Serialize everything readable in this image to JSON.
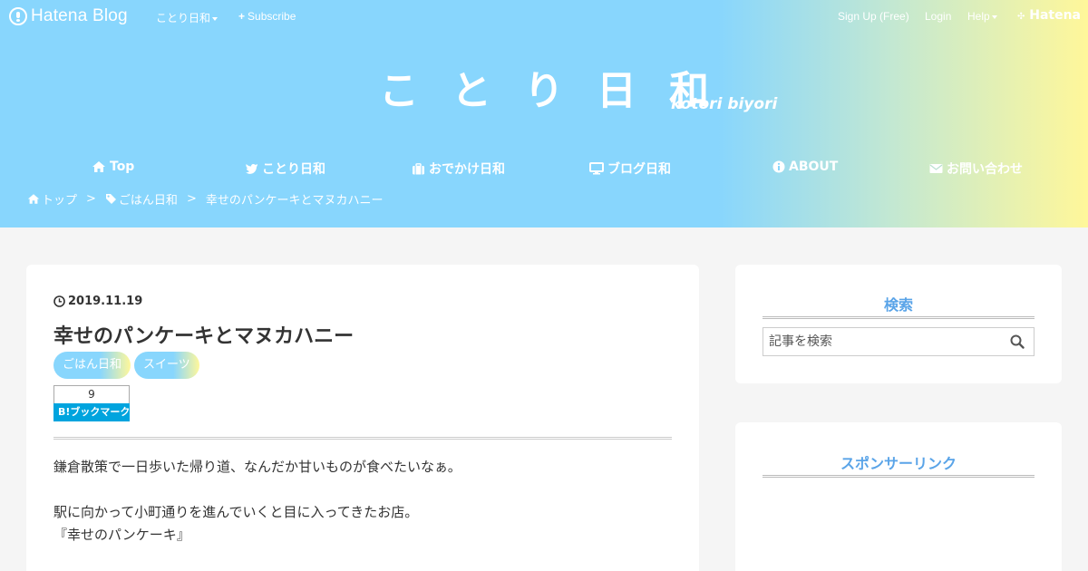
{
  "topbar": {
    "brand": "Hatena Blog",
    "blog_menu": "ことり日和",
    "subscribe": "Subscribe",
    "signup": "Sign Up (Free)",
    "login": "Login",
    "help": "Help",
    "hatena": "Hatena"
  },
  "site": {
    "title": "ことり日和",
    "subtitle": "kotori biyori"
  },
  "gnav": {
    "items": [
      {
        "label": "Top",
        "icon": "home-icon"
      },
      {
        "label": "ことり日和",
        "icon": "bird-icon"
      },
      {
        "label": "おでかけ日和",
        "icon": "suitcase-icon"
      },
      {
        "label": "ブログ日和",
        "icon": "monitor-icon"
      },
      {
        "label": "ABOUT",
        "icon": "info-icon"
      },
      {
        "label": "お問い合わせ",
        "icon": "envelope-icon"
      }
    ]
  },
  "breadcrumb": {
    "home": "トップ",
    "sep1": ">",
    "category": "ごはん日和",
    "sep2": ">",
    "current": "幸せのパンケーキとマヌカハニー"
  },
  "entry": {
    "date": "2019.11.19",
    "title": "幸せのパンケーキとマヌカハニー",
    "categories": [
      "ごはん日和",
      "スイーツ"
    ],
    "bookmark_count": "9",
    "bookmark_label": "B!ブックマーク",
    "paragraphs": [
      "鎌倉散策で一日歩いた帰り道、なんだか甘いものが食べたいなぁ。",
      "駅に向かって小町通りを進んでいくと目に入ってきたお店。",
      "『幸せのパンケーキ』"
    ]
  },
  "sidebar": {
    "search_title": "検索",
    "search_placeholder": "記事を検索",
    "sponsor_title": "スポンサーリンク"
  },
  "colors": {
    "header_blue": "#88d6fd",
    "header_yellow": "#fff79a",
    "accent_blue": "#5aa4e8",
    "bookmark_blue": "#00a4de"
  }
}
